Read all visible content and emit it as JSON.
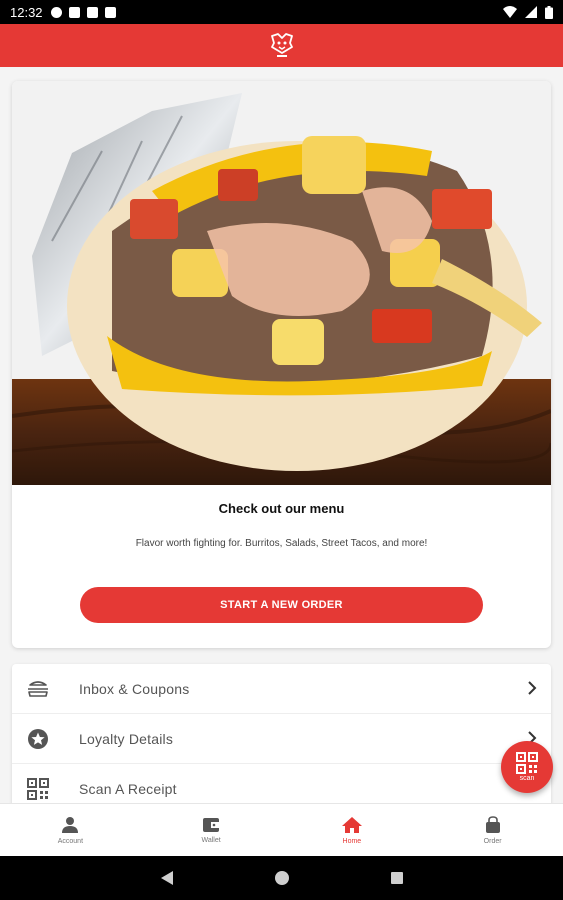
{
  "status_bar": {
    "time": "12:32"
  },
  "hero": {
    "title": "Check out our menu",
    "subtitle": "Flavor worth fighting for. Burritos, Salads, Street Tacos, and more!",
    "cta_label": "START A NEW ORDER"
  },
  "menu": {
    "items": [
      {
        "label": "Inbox & Coupons",
        "icon": "inbox-icon"
      },
      {
        "label": "Loyalty Details",
        "icon": "star-icon"
      },
      {
        "label": "Scan A Receipt",
        "icon": "qr-code-icon"
      }
    ]
  },
  "fab": {
    "label": "scan"
  },
  "bottom_nav": {
    "items": [
      {
        "label": "Account",
        "icon": "person-icon",
        "active": false
      },
      {
        "label": "Wallet",
        "icon": "wallet-icon",
        "active": false
      },
      {
        "label": "Home",
        "icon": "home-icon",
        "active": true
      },
      {
        "label": "Order",
        "icon": "bag-icon",
        "active": false
      }
    ]
  },
  "colors": {
    "brand": "#e53935",
    "background": "#f4f4f4"
  }
}
